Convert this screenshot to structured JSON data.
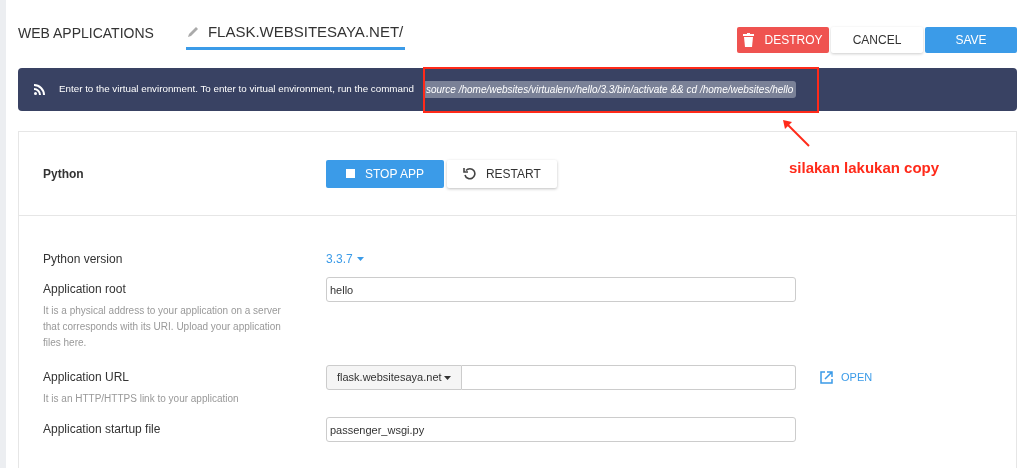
{
  "header": {
    "breadcrumb": "WEB APPLICATIONS",
    "app_name": "FLASK.WEBSITESAYA.NET/"
  },
  "actions": [
    {
      "kind": "danger",
      "label": "DESTROY"
    },
    {
      "kind": "plain",
      "label": "CANCEL"
    },
    {
      "kind": "primary",
      "label": "SAVE"
    }
  ],
  "banner": {
    "text": "Enter to the virtual environment. To enter to virtual environment, run the command",
    "command": "source /home/websites/virtualenv/hello/3.3/bin/activate && cd /home/websites/hello"
  },
  "annotation": {
    "text": "silakan lakukan copy"
  },
  "app_panel": {
    "title": "Python",
    "buttons": [
      {
        "kind": "primary",
        "label": "STOP APP"
      },
      {
        "kind": "plain",
        "label": "RESTART"
      }
    ]
  },
  "fields": [
    {
      "kind": "dropdown",
      "label": "Python version",
      "value": "3.3.7"
    },
    {
      "kind": "text",
      "label": "Application root",
      "value": "hello",
      "description": "It is a physical address to your application on a server that corresponds with its URI. Upload your application files here."
    },
    {
      "kind": "url",
      "label": "Application URL",
      "domain": "flask.websitesaya.net",
      "link": "OPEN",
      "description": "It is an HTTP/HTTPS link to your application"
    },
    {
      "kind": "text",
      "label": "Application startup file",
      "value": "passenger_wsgi.py"
    }
  ]
}
